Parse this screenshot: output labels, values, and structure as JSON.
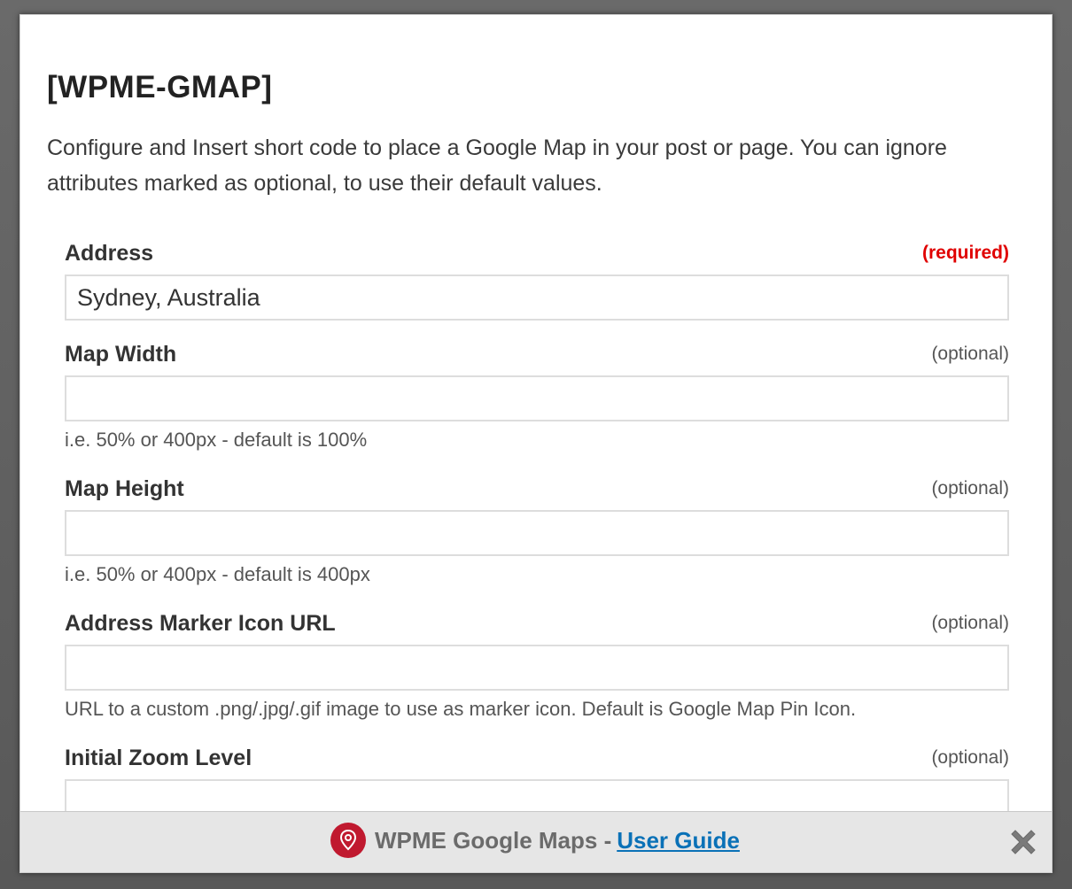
{
  "dialog": {
    "title": "[WPME-GMAP]",
    "intro": "Configure and Insert short code to place a Google Map in your post or page. You can ignore attributes marked as optional, to use their default values."
  },
  "fields": [
    {
      "label": "Address",
      "tag": "(required)",
      "value": "Sydney, Australia",
      "hint": ""
    },
    {
      "label": "Map Width",
      "tag": "(optional)",
      "value": "",
      "hint": "i.e. 50% or 400px - default is 100%"
    },
    {
      "label": "Map Height",
      "tag": "(optional)",
      "value": "",
      "hint": "i.e. 50% or 400px - default is 400px"
    },
    {
      "label": "Address Marker Icon URL",
      "tag": "(optional)",
      "value": "",
      "hint": "URL to a custom .png/.jpg/.gif image to use as marker icon. Default is Google Map Pin Icon."
    },
    {
      "label": "Initial Zoom Level",
      "tag": "(optional)",
      "value": "",
      "hint": ""
    }
  ],
  "footer": {
    "brand": "WPME Google Maps -",
    "link": "User Guide",
    "icon": "map-pin-icon",
    "close_icon": "close-icon"
  },
  "colors": {
    "required": "#e00000",
    "link": "#0a71b7",
    "pin_badge": "#c0192f",
    "footer_bg": "#e6e6e6"
  }
}
